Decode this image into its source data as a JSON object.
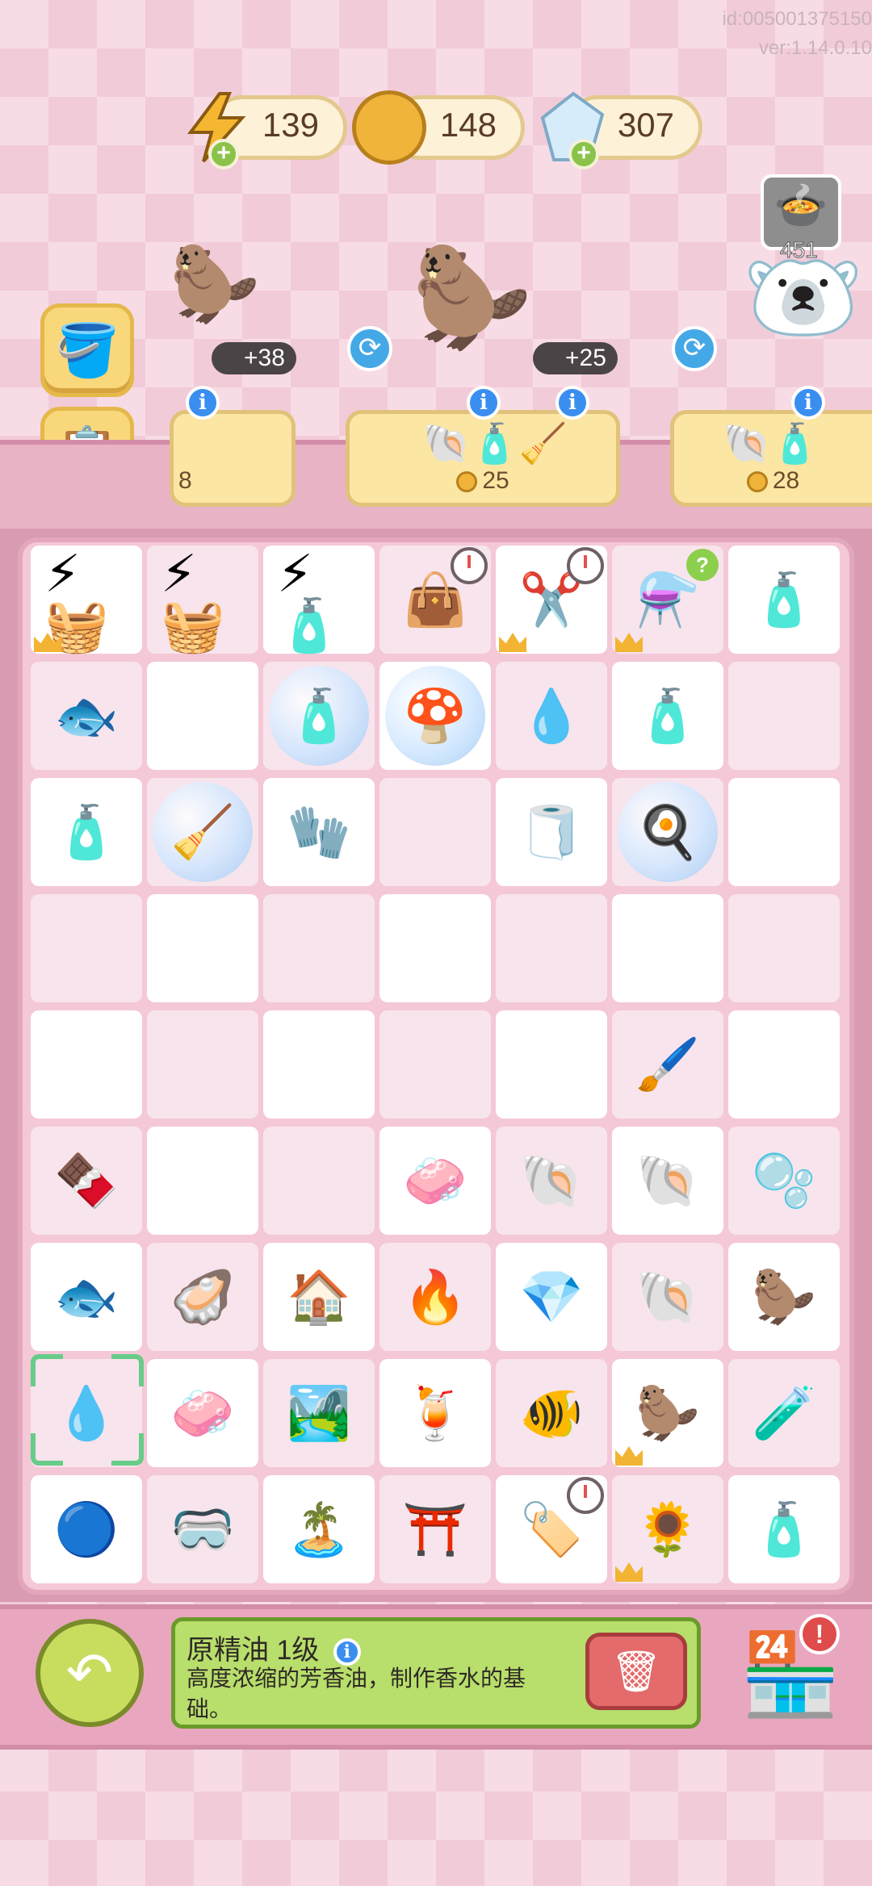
{
  "meta": {
    "id_text": "id:005001375150",
    "version_text": "ver:1.14.0.10"
  },
  "currencies": {
    "energy": {
      "value": "139",
      "icon": "lightning-icon",
      "color": "#f5b731"
    },
    "coins": {
      "value": "148",
      "icon": "coin-icon",
      "color": "#f0b43a"
    },
    "gems": {
      "value": "307",
      "icon": "crystal-icon",
      "color": "#bfe0f4"
    }
  },
  "tools": [
    {
      "name": "paint-bucket-icon"
    },
    {
      "name": "clipboard-icon"
    }
  ],
  "customers": [
    {
      "name": "capybara-customer-left",
      "bonus": "+38",
      "price": "8"
    },
    {
      "name": "capybara-customer-center",
      "bonus": "+25",
      "price": "25"
    },
    {
      "name": "polar-bear-customer",
      "bonus": "",
      "price": "28",
      "soup_count": "451"
    }
  ],
  "board": {
    "rows": [
      [
        "⚡🧺",
        "⚡🧺",
        "⚡🧴",
        "👜",
        "✂️",
        "⚗️",
        "🧴"
      ],
      [
        "🐟",
        "",
        "🧴",
        "🍄",
        "💧",
        "🧴",
        ""
      ],
      [
        "🧴",
        "🧹",
        "🧤",
        "",
        "🧻",
        "🍳",
        ""
      ],
      [
        "",
        "",
        "",
        "",
        "",
        "",
        ""
      ],
      [
        "",
        "",
        "",
        "",
        "",
        "🖌️",
        ""
      ],
      [
        "🍫",
        "",
        "",
        "🧼",
        "🐚",
        "🐚",
        "🫧"
      ],
      [
        "🐟",
        "🦪",
        "🏠",
        "🔥",
        "💎",
        "🐚",
        "🦫"
      ],
      [
        "💧",
        "🧼",
        "🏞️",
        "🍹",
        "🐠",
        "🦫",
        "🧪"
      ],
      [
        "🔵",
        "🥽",
        "🏝️",
        "⛩️",
        "🏷️",
        "🌻",
        "🧴"
      ]
    ]
  },
  "selected_item": {
    "title": "原精油 1级",
    "description": "高度浓缩的芳香油，制作香水的基础。"
  },
  "buttons": {
    "back": "back-arrow-icon",
    "trash": "trash-icon",
    "shop": "shop-icon",
    "shop_alert": "!"
  }
}
